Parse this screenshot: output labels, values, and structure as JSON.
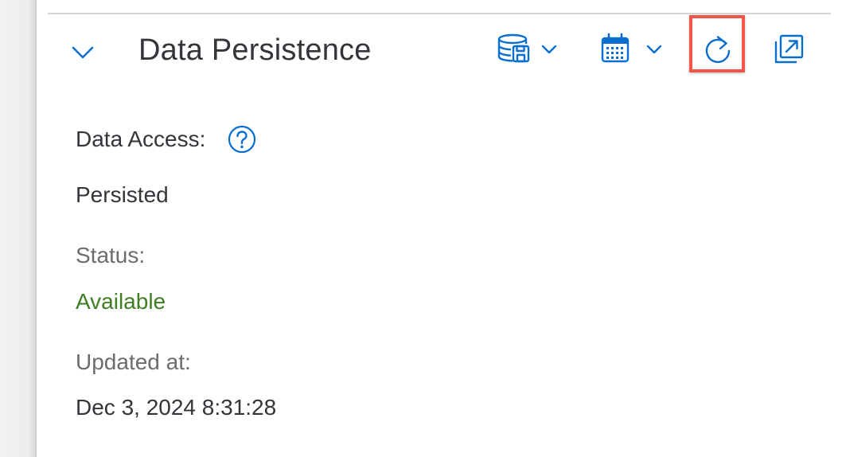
{
  "section": {
    "title": "Data Persistence"
  },
  "toolbar": {
    "icons": {
      "collapse": "chevron-down-icon",
      "persistence_menu": "database-save-icon",
      "schedule_menu": "calendar-icon",
      "refresh": "refresh-icon",
      "open_external": "open-in-new-window-icon"
    }
  },
  "fields": {
    "data_access_label": "Data Access:",
    "data_access_value": "Persisted",
    "status_label": "Status:",
    "status_value": "Available",
    "updated_label": "Updated at:",
    "updated_value": "Dec 3, 2024 8:31:28"
  },
  "colors": {
    "icon_blue": "#0a6ed1",
    "text_primary": "#32363a",
    "text_secondary": "#6a6d70",
    "status_available": "#3d7f23",
    "highlight_box": "#f2574a"
  }
}
